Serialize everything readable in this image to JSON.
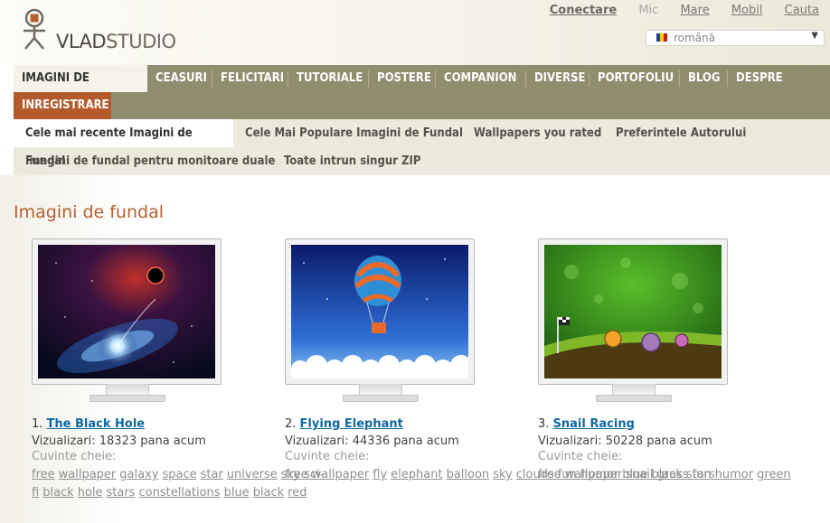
{
  "header": {
    "logo": {
      "bold": "VLAD",
      "rest": "STUDIO"
    },
    "links": {
      "login": "Conectare",
      "small": "Mic",
      "large": "Mare",
      "mobile": "Mobil",
      "search": "Cauta"
    },
    "language": {
      "selected": "română"
    }
  },
  "nav": {
    "items": [
      "IMAGINI DE FUNDAL",
      "CEASURI",
      "FELICITARI",
      "TUTORIALE",
      "POSTERE",
      "COMPANION",
      "DIVERSE",
      "PORTOFOLIU",
      "BLOG",
      "DESPRE"
    ],
    "register": "INREGISTRARE"
  },
  "subnav": {
    "items": [
      "Cele mai recente Imagini de Fundal",
      "Cele Mai Populare Imagini de Fundal",
      "Wallpapers you rated",
      "Preferintele Autorului",
      "Imagini de fundal pentru monitoare duale",
      "Toate intrun singur ZIP"
    ]
  },
  "main": {
    "title": "Imagini de fundal",
    "views_label": "Vizualizari:",
    "views_suffix": "pana acum",
    "keywords_label": "Cuvinte cheie:",
    "wallpapers": [
      {
        "num": "1.",
        "title": "The Black Hole",
        "views": "18323",
        "keywords": [
          "free",
          "wallpaper",
          "galaxy",
          "space",
          "star",
          "universe",
          "sky",
          "sci-fi",
          "black",
          "hole",
          "stars",
          "constellations",
          "blue",
          "black",
          "red"
        ]
      },
      {
        "num": "2.",
        "title": "Flying Elephant",
        "views": "44336",
        "keywords": [
          "free",
          "wallpaper",
          "fly",
          "elephant",
          "balloon",
          "sky",
          "clouds",
          "fun",
          "humor",
          "blue",
          "black",
          "stars"
        ]
      },
      {
        "num": "3.",
        "title": "Snail Racing",
        "views": "50228",
        "keywords": [
          "free",
          "wallpaper",
          "snail",
          "grass",
          "fun",
          "humor",
          "green"
        ]
      }
    ]
  },
  "colors": {
    "accent": "#b5602f",
    "nav_bg": "#918d6f",
    "link": "#0f6aa3",
    "register_bg": "#b55b2b"
  }
}
